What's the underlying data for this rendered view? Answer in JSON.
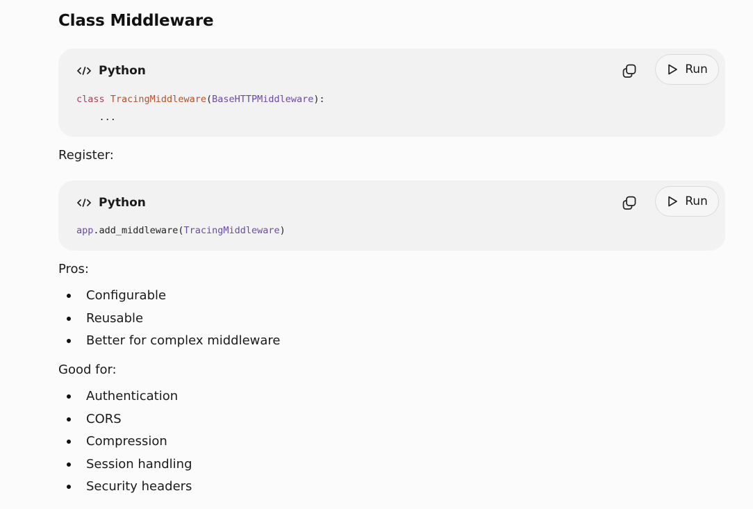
{
  "heading": "Class Middleware",
  "code_blocks": [
    {
      "language": "Python",
      "run_label": "Run",
      "lines": [
        {
          "kw": "class",
          "sp1": " ",
          "fn": "TracingMiddleware",
          "p1": "(",
          "cls": "BaseHTTPMiddleware",
          "p2": "):"
        },
        {
          "indent": "    ",
          "text": "..."
        }
      ]
    },
    {
      "language": "Python",
      "run_label": "Run",
      "lines": [
        {
          "obj": "app",
          "dot": ".",
          "method": "add_middleware",
          "p1": "(",
          "cls": "TracingMiddleware",
          "p2": ")"
        }
      ]
    }
  ],
  "register_label": "Register:",
  "pros_label": "Pros:",
  "pros": [
    "Configurable",
    "Reusable",
    "Better for complex middleware"
  ],
  "good_for_label": "Good for:",
  "good_for": [
    "Authentication",
    "CORS",
    "Compression",
    "Session handling",
    "Security headers"
  ],
  "colors": {
    "background": "#fbfbfb",
    "code_block_bg": "#f2f2f2",
    "keyword": "#a3445a",
    "function_name": "#b5522b",
    "class_name": "#6a4aa8"
  },
  "icons": [
    "code-icon",
    "copy-icon",
    "play-icon"
  ]
}
